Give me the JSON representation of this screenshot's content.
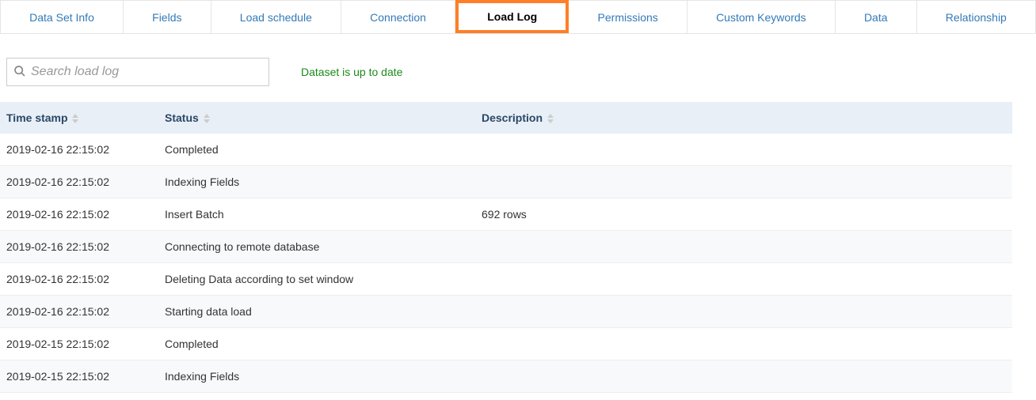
{
  "tabs": [
    {
      "label": "Data Set Info",
      "active": false
    },
    {
      "label": "Fields",
      "active": false
    },
    {
      "label": "Load schedule",
      "active": false
    },
    {
      "label": "Connection",
      "active": false
    },
    {
      "label": "Load Log",
      "active": true
    },
    {
      "label": "Permissions",
      "active": false
    },
    {
      "label": "Custom Keywords",
      "active": false
    },
    {
      "label": "Data",
      "active": false
    },
    {
      "label": "Relationship",
      "active": false
    }
  ],
  "search": {
    "placeholder": "Search load log"
  },
  "status_message": "Dataset is up to date",
  "table": {
    "headers": {
      "timestamp": "Time stamp",
      "status": "Status",
      "description": "Description"
    },
    "rows": [
      {
        "timestamp": "2019-02-16 22:15:02",
        "status": "Completed",
        "description": ""
      },
      {
        "timestamp": "2019-02-16 22:15:02",
        "status": "Indexing Fields",
        "description": ""
      },
      {
        "timestamp": "2019-02-16 22:15:02",
        "status": "Insert Batch",
        "description": "692 rows"
      },
      {
        "timestamp": "2019-02-16 22:15:02",
        "status": "Connecting to remote database",
        "description": ""
      },
      {
        "timestamp": "2019-02-16 22:15:02",
        "status": "Deleting Data according to set window",
        "description": ""
      },
      {
        "timestamp": "2019-02-16 22:15:02",
        "status": "Starting data load",
        "description": ""
      },
      {
        "timestamp": "2019-02-15 22:15:02",
        "status": "Completed",
        "description": ""
      },
      {
        "timestamp": "2019-02-15 22:15:02",
        "status": "Indexing Fields",
        "description": ""
      }
    ]
  }
}
